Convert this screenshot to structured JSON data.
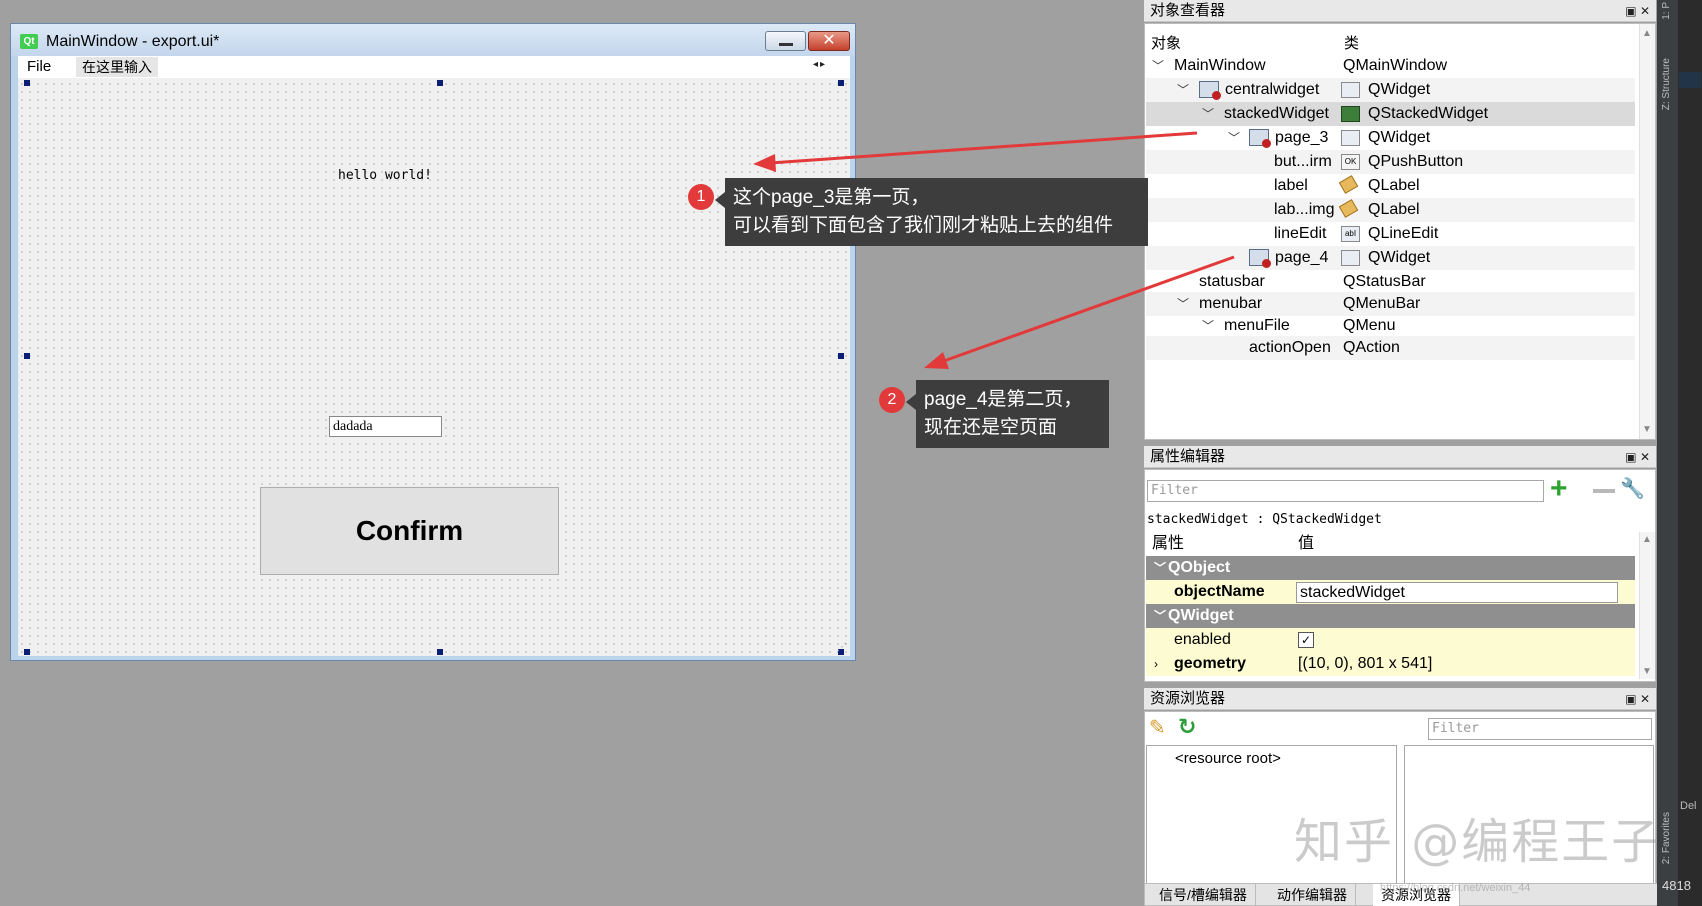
{
  "designer_window": {
    "title": "MainWindow - export.ui*",
    "menu_file": "File",
    "menu_type_here": "在这里输入",
    "label_text": "hello world!",
    "line_edit_value": "dadada",
    "confirm_label": "Confirm",
    "logo_text": "Qt"
  },
  "object_inspector": {
    "title": "对象查看器",
    "col_object": "对象",
    "col_class": "类",
    "rows": [
      {
        "name": "MainWindow",
        "cls": "QMainWindow"
      },
      {
        "name": "centralwidget",
        "cls": "QWidget"
      },
      {
        "name": "stackedWidget",
        "cls": "QStackedWidget"
      },
      {
        "name": "page_3",
        "cls": "QWidget"
      },
      {
        "name": "but...irm",
        "cls": "QPushButton"
      },
      {
        "name": "label",
        "cls": "QLabel"
      },
      {
        "name": "lab...img",
        "cls": "QLabel"
      },
      {
        "name": "lineEdit",
        "cls": "QLineEdit"
      },
      {
        "name": "page_4",
        "cls": "QWidget"
      },
      {
        "name": "statusbar",
        "cls": "QStatusBar"
      },
      {
        "name": "menubar",
        "cls": "QMenuBar"
      },
      {
        "name": "menuFile",
        "cls": "QMenu"
      },
      {
        "name": "actionOpen",
        "cls": "QAction"
      }
    ]
  },
  "property_editor": {
    "title": "属性编辑器",
    "filter_placeholder": "Filter",
    "object_line": "stackedWidget : QStackedWidget",
    "col_property": "属性",
    "col_value": "值",
    "group_qobject": "QObject",
    "object_name_label": "objectName",
    "object_name_value": "stackedWidget",
    "group_qwidget": "QWidget",
    "enabled_label": "enabled",
    "enabled_checked": "✓",
    "geometry_label": "geometry",
    "geometry_value": "[(10, 0), 801 x 541]"
  },
  "resource_browser": {
    "title": "资源浏览器",
    "filter_placeholder": "Filter",
    "root_item": "<resource root>",
    "tabs": [
      "信号/槽编辑器",
      "动作编辑器",
      "资源浏览器"
    ]
  },
  "side_labels": {
    "structure": "Z: Structure",
    "favorites": "2: Favorites",
    "top": "1: P",
    "del": "Del"
  },
  "annotations": {
    "badge1": "1",
    "callout1_line1": "这个page_3是第一页，",
    "callout1_line2": "可以看到下面包含了我们刚才粘贴上去的组件",
    "badge2": "2",
    "callout2_line1": "page_4是第二页，",
    "callout2_line2": "现在还是空页面",
    "arrow_color": "#e23a3a"
  },
  "watermark": {
    "text": "知乎 @编程王子",
    "url": "https://blog.csdn.net/weixin_44",
    "corner": "4818"
  }
}
